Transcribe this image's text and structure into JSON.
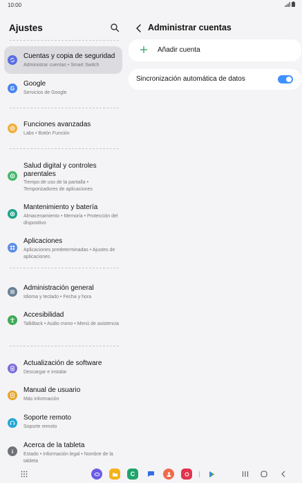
{
  "status": {
    "time": "10:00"
  },
  "settings": {
    "title": "Ajustes",
    "items": [
      {
        "title": "Cuentas y copia de seguridad",
        "subtitle": "Administrar cuentas  •  Smart Switch",
        "color": "#5b6ee0",
        "icon": "sync-icon"
      },
      {
        "title": "Google",
        "subtitle": "Servicios de Google",
        "color": "#4a85f0",
        "icon": "google-icon"
      },
      {
        "title": "Funciones avanzadas",
        "subtitle": "Labs  •  Botón Función",
        "color": "#f2b03c",
        "icon": "gear-plus-icon"
      },
      {
        "title": "Salud digital y controles parentales",
        "subtitle": "Tiempo de uso de la pantalla  •  Temporizadores de aplicaciones",
        "color": "#47b86a",
        "icon": "digital-wellbeing-icon"
      },
      {
        "title": "Mantenimiento y batería",
        "subtitle": "Almacenamiento  •  Memoria  •  Protección del dispositivo",
        "color": "#1ea38a",
        "icon": "device-care-icon"
      },
      {
        "title": "Aplicaciones",
        "subtitle": "Aplicaciones predeterminadas  •  Ajustes de aplicaciones",
        "color": "#5b8de9",
        "icon": "apps-icon"
      },
      {
        "title": "Administración general",
        "subtitle": "Idioma y teclado  •  Fecha y hora",
        "color": "#6a8296",
        "icon": "sliders-icon"
      },
      {
        "title": "Accesibilidad",
        "subtitle": "TalkBack  •  Audio mono  •  Menú de asistencia",
        "color": "#3fab57",
        "icon": "accessibility-icon"
      },
      {
        "title": "Actualización de software",
        "subtitle": "Descargar e instalar",
        "color": "#7a6cdc",
        "icon": "software-update-icon"
      },
      {
        "title": "Manual de usuario",
        "subtitle": "Más información",
        "color": "#e7a62b",
        "icon": "manual-icon"
      },
      {
        "title": "Soporte remoto",
        "subtitle": "Soporte remoto",
        "color": "#22a7d6",
        "icon": "headset-icon"
      },
      {
        "title": "Acerca de la tableta",
        "subtitle": "Estado  •  Información legal  •  Nombre de la tableta",
        "color": "#707277",
        "icon": "info-icon"
      }
    ]
  },
  "accounts": {
    "title": "Administrar cuentas",
    "add_account": "Añadir cuenta",
    "auto_sync": "Sincronización automática de datos",
    "auto_sync_on": true,
    "accent": "#3e91ff"
  },
  "dock": {
    "apps": [
      {
        "icon": "internet-icon",
        "color": "#6a5ce6"
      },
      {
        "icon": "my-files-icon",
        "color": "#f5b21c"
      },
      {
        "icon": "phone-icon",
        "color": "#1fa46c"
      },
      {
        "icon": "messages-icon",
        "color": "#2f6ee5"
      },
      {
        "icon": "contacts-icon",
        "color": "#ef6b4c"
      },
      {
        "icon": "camera-icon",
        "color": "#e2334f"
      },
      {
        "icon": "play-store-icon",
        "color": "#34a853"
      }
    ]
  }
}
